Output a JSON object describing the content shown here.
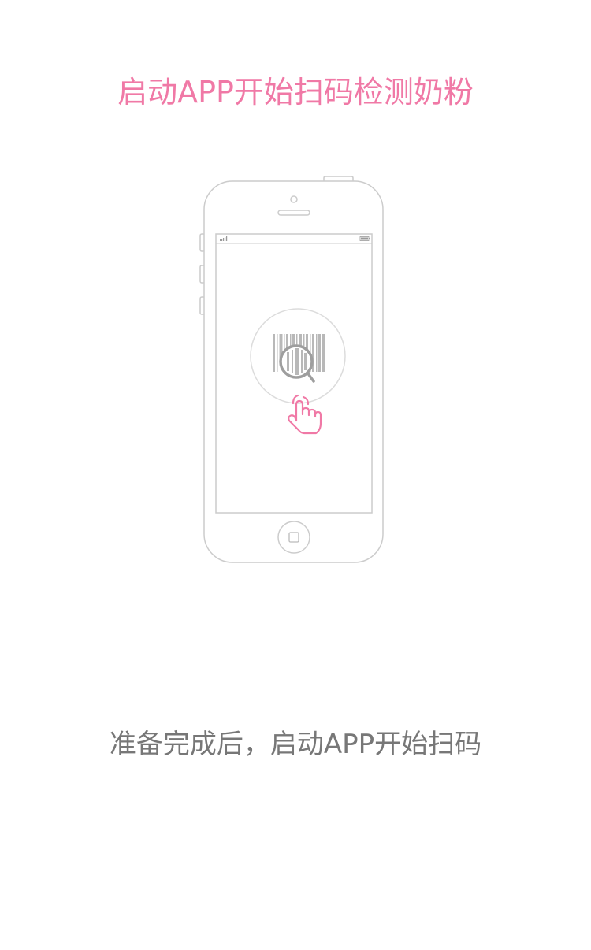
{
  "header": {
    "title": "启动APP开始扫码检测奶粉"
  },
  "illustration": {
    "device": "phone-outline",
    "icons": [
      "barcode-icon",
      "magnifier-icon",
      "tap-hand-icon"
    ]
  },
  "footer": {
    "instruction": "准备完成后，启动APP开始扫码"
  },
  "colors": {
    "accent": "#f079a6",
    "outline": "#c8c8c8",
    "barcode": "#b8b8b8",
    "text": "#777777"
  }
}
